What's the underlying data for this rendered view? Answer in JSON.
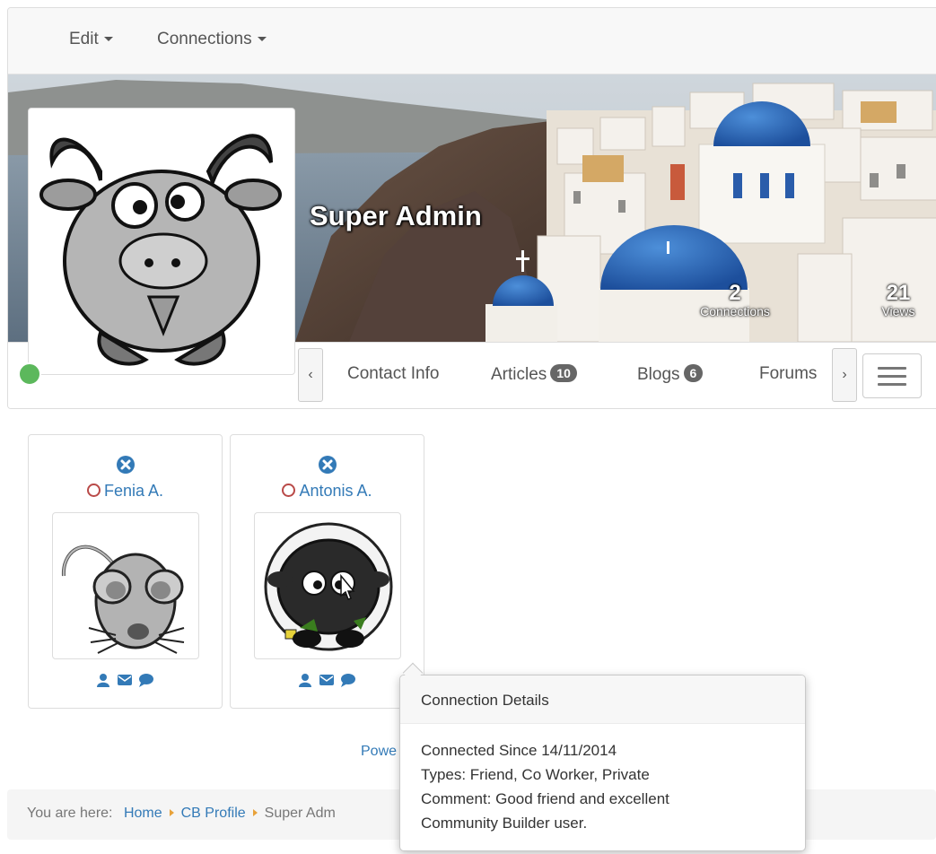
{
  "menu": {
    "edit": "Edit",
    "connections": "Connections"
  },
  "profile": {
    "display_name": "Super Admin",
    "stats": [
      {
        "value": "2",
        "label": "Connections"
      },
      {
        "value": "21",
        "label": "Views"
      }
    ],
    "status_color": "#5cb85c"
  },
  "tabs": {
    "prev": "‹",
    "next": "›",
    "items": [
      {
        "label": "Contact Info",
        "badge": null
      },
      {
        "label": "Articles",
        "badge": "10"
      },
      {
        "label": "Blogs",
        "badge": "6"
      },
      {
        "label": "Forums",
        "badge": null
      }
    ]
  },
  "connections": [
    {
      "name": "Fenia A.",
      "avatar": "mouse"
    },
    {
      "name": "Antonis A.",
      "avatar": "sheep"
    }
  ],
  "footer": {
    "powered": "Powe"
  },
  "tooltip": {
    "title": "Connection Details",
    "lines": [
      "Connected Since 14/11/2014",
      "Types: Friend, Co Worker, Private",
      "Comment: Good friend and excellent",
      "Community Builder user."
    ]
  },
  "breadcrumb": {
    "prefix": "You are here:",
    "items": [
      "Home",
      "CB Profile",
      "Super Adm"
    ]
  },
  "colors": {
    "link": "#337ab7",
    "offline": "#b94a48",
    "badge": "#666666"
  }
}
